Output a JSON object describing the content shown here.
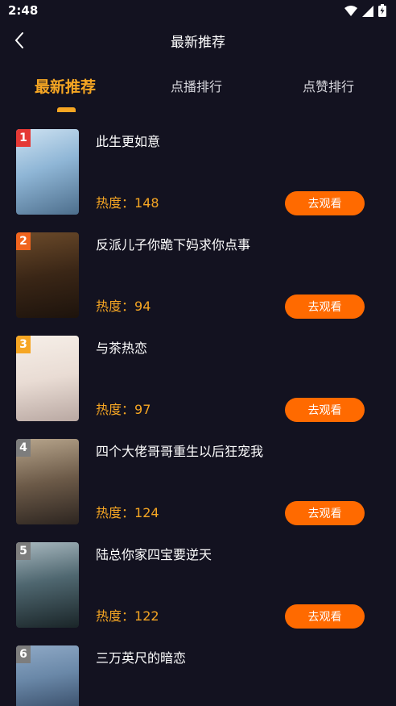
{
  "status_bar": {
    "time": "2:48",
    "icons": [
      "wifi-icon",
      "signal-icon",
      "battery-icon"
    ]
  },
  "header": {
    "title": "最新推荐",
    "back_icon": "chevron-left-icon"
  },
  "tabs": [
    {
      "label": "最新推荐",
      "active": true
    },
    {
      "label": "点播排行",
      "active": false
    },
    {
      "label": "点赞排行",
      "active": false
    }
  ],
  "colors": {
    "background": "#131220",
    "accent": "#f6a623",
    "button": "#ff6a00",
    "rank1": "#e53935",
    "rank2": "#f0641e",
    "rank3": "#f6a623",
    "rank_other": "#7d7d7d"
  },
  "list": {
    "heat_label": "热度：",
    "watch_label": "去观看",
    "items": [
      {
        "rank": "1",
        "title": "此生更如意",
        "heat": "148"
      },
      {
        "rank": "2",
        "title": "反派儿子你跪下妈求你点事",
        "heat": "94"
      },
      {
        "rank": "3",
        "title": "与茶热恋",
        "heat": "97"
      },
      {
        "rank": "4",
        "title": "四个大佬哥哥重生以后狂宠我",
        "heat": "124"
      },
      {
        "rank": "5",
        "title": "陆总你家四宝要逆天",
        "heat": "122"
      },
      {
        "rank": "6",
        "title": "三万英尺的暗恋",
        "heat": ""
      }
    ]
  }
}
